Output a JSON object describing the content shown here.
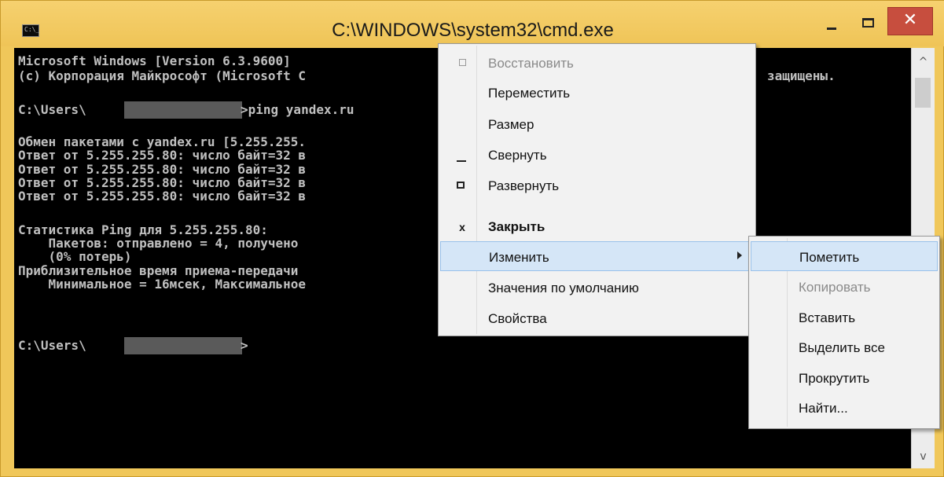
{
  "window": {
    "title": "C:\\WINDOWS\\system32\\cmd.exe",
    "icon_text": "C:\\_",
    "colors": {
      "frame": "#f0c75a",
      "close": "#c74e3e",
      "console_bg": "#000000",
      "console_text": "#c0c0c0",
      "highlight": "#d5e6f7"
    }
  },
  "console": {
    "lines": [
      "Microsoft Windows [Version 6.3.9600]",
      "(c) Корпорация Майкрософт (Microsoft C",
      "C:\\Users\\",
      ">ping yandex.ru",
      "Обмен пакетами с yandex.ru [5.255.255.",
      "Ответ от 5.255.255.80: число байт=32 в",
      "Ответ от 5.255.255.80: число байт=32 в",
      "Ответ от 5.255.255.80: число байт=32 в",
      "Ответ от 5.255.255.80: число байт=32 в",
      "Статистика Ping для 5.255.255.80:",
      "    Пакетов: отправлено = 4, получено",
      "    (0% потерь)",
      "Приблизительное время приема-передачи",
      "    Минимальное = 16мсек, Максимальное",
      "C:\\Users\\",
      ">",
      "защищены."
    ]
  },
  "context_menu": {
    "items": [
      {
        "label": "Восстановить",
        "icon": "restore-icon"
      },
      {
        "label": "Переместить"
      },
      {
        "label": "Размер"
      },
      {
        "label": "Свернуть",
        "icon": "minimize-icon"
      },
      {
        "label": "Развернуть",
        "icon": "maximize-icon"
      },
      {
        "label": "Закрыть",
        "icon": "close-icon",
        "icon_glyph": "x"
      },
      {
        "label": "Изменить",
        "icon": "chevron-right-icon"
      },
      {
        "label": "Значения по умолчанию"
      },
      {
        "label": "Свойства"
      }
    ]
  },
  "submenu": {
    "items": [
      {
        "label": "Пометить"
      },
      {
        "label": "Копировать"
      },
      {
        "label": "Вставить"
      },
      {
        "label": "Выделить все"
      },
      {
        "label": "Прокрутить"
      },
      {
        "label": "Найти..."
      }
    ]
  },
  "scrollbar": {
    "up_icon": "chevron-up-icon",
    "down_icon": "chevron-down-icon",
    "up_glyph": "^",
    "down_glyph": "v"
  }
}
